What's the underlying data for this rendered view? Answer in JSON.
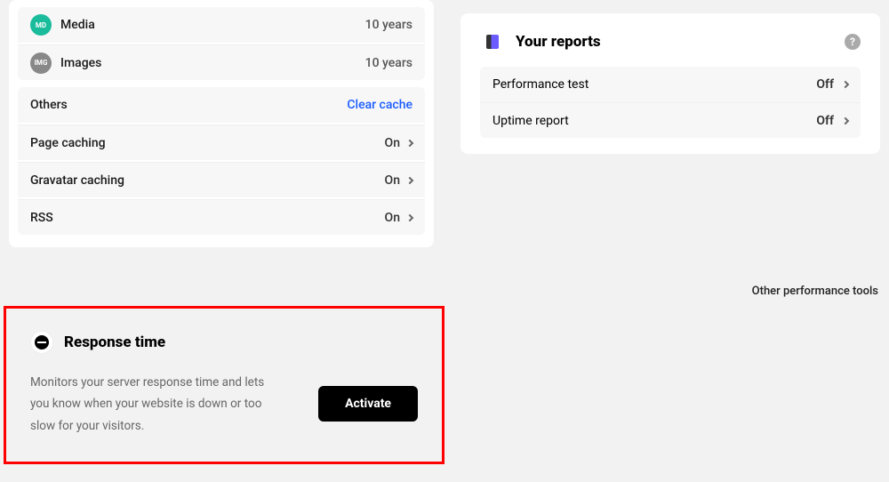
{
  "cache_groups": [
    {
      "items": [
        {
          "icon": "MD",
          "icon_class": "ic-md",
          "label": "Media",
          "value": "10 years"
        },
        {
          "icon": "IMG",
          "icon_class": "ic-img",
          "label": "Images",
          "value": "10 years"
        }
      ]
    },
    {
      "header": {
        "label": "Others",
        "action": "Clear cache"
      },
      "items": [
        {
          "label": "Page caching",
          "value": "On"
        },
        {
          "label": "Gravatar caching",
          "value": "On"
        },
        {
          "label": "RSS",
          "value": "On"
        }
      ]
    }
  ],
  "reports": {
    "title": "Your reports",
    "items": [
      {
        "label": "Performance test",
        "value": "Off"
      },
      {
        "label": "Uptime report",
        "value": "Off"
      }
    ]
  },
  "other_tools_label": "Other performance tools",
  "response_time": {
    "title": "Response time",
    "description": "Monitors your server response time and lets you know when your website is down or too slow for your visitors.",
    "button": "Activate"
  }
}
